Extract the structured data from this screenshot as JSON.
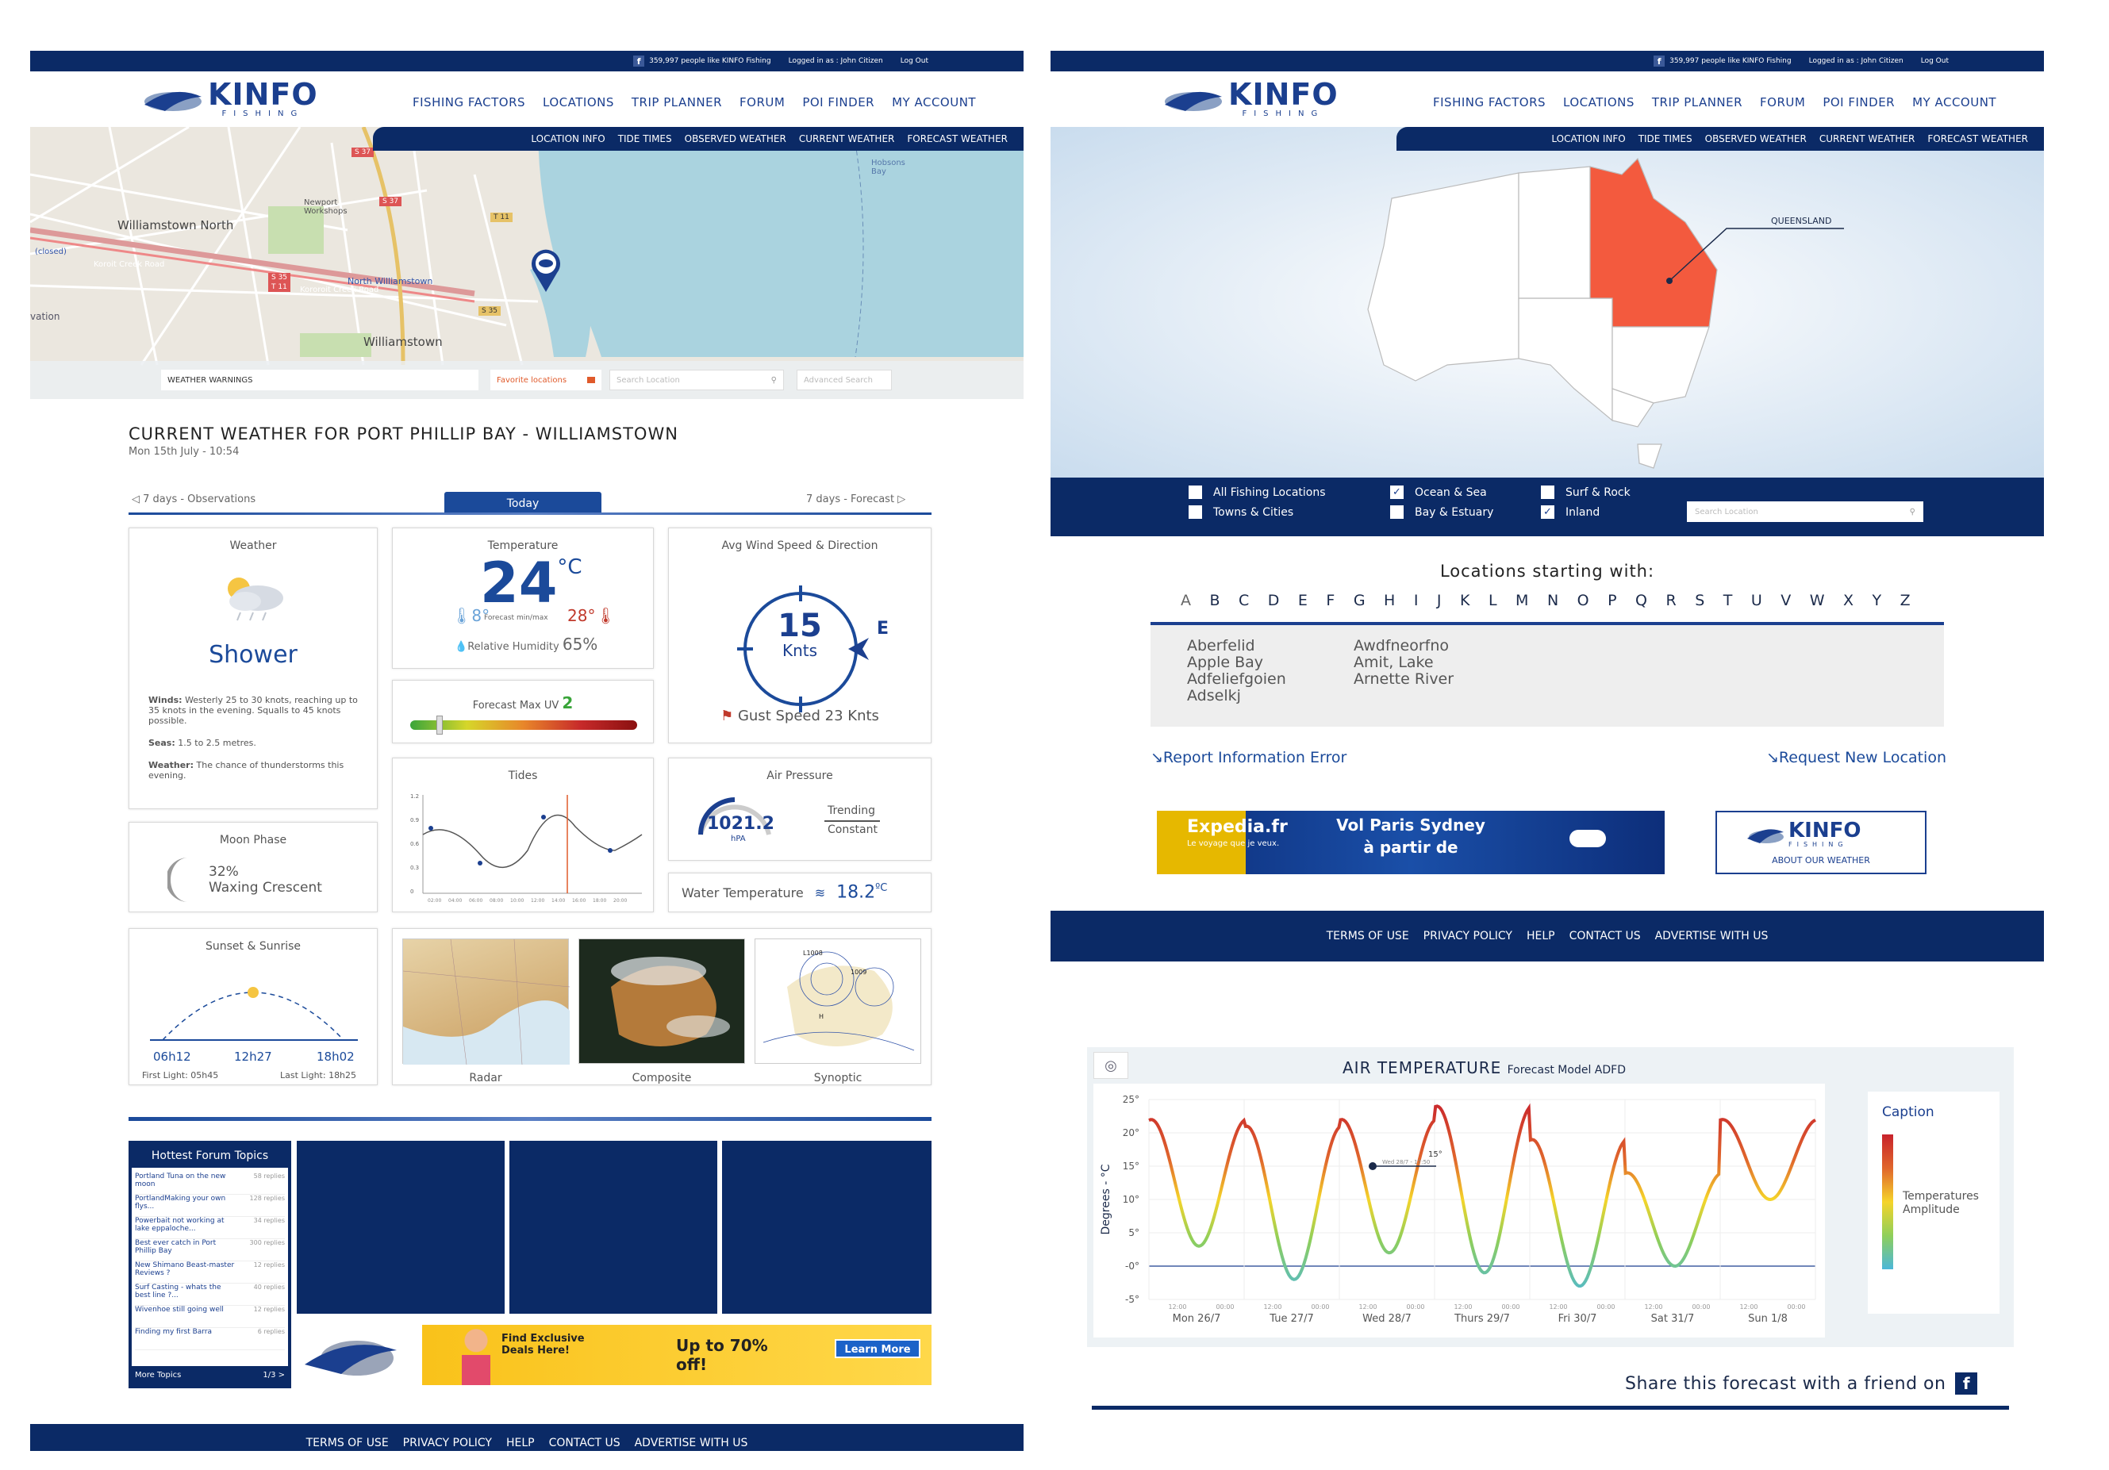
{
  "facebook": {
    "likes_text": "359,997 people like KINFO Fishing"
  },
  "user": {
    "logged_in_text": "Logged in as : John Citizen",
    "logout_label": "Log Out"
  },
  "brand": {
    "name": "KINFO",
    "sub": "FISHING",
    "about_weather": "ABOUT OUR WEATHER"
  },
  "main_nav": [
    "FISHING FACTORS",
    "LOCATIONS",
    "TRIP PLANNER",
    "FORUM",
    "POI FINDER",
    "MY ACCOUNT"
  ],
  "sub_nav": [
    "LOCATION INFO",
    "TIDE TIMES",
    "OBSERVED WEATHER",
    "CURRENT WEATHER",
    "FORECAST WEATHER"
  ],
  "map": {
    "labels": [
      "Williamstown North",
      "Williamstown",
      "North Williamstown",
      "Koroit Creek Road",
      "Kororoit Creek Road",
      "(closed)",
      "Newport Workshops",
      "Hobsons Bay",
      "S 37",
      "S 37",
      "T 11",
      "S 35",
      "T 11",
      "S 35",
      "vation"
    ],
    "weather_warnings": "WEATHER WARNINGS",
    "favorite_locations": "Favorite locations",
    "search_placeholder": "Search Location",
    "advanced_search": "Advanced Search"
  },
  "current": {
    "title": "CURRENT WEATHER FOR PORT PHILLIP BAY - WILLIAMSTOWN",
    "date": "Mon 15th July - 10:54",
    "tab_prev": "7 days - Observations",
    "tab_today": "Today",
    "tab_next": "7 days - Forecast",
    "weather": {
      "title": "Weather",
      "condition": "Shower",
      "winds_label": "Winds:",
      "winds_text": "Westerly 25 to 30 knots, reaching up to 35 knots in the evening. Squalls to 45 knots possible.",
      "seas_label": "Seas:",
      "seas_text": "1.5 to 2.5 metres.",
      "weather_label": "Weather:",
      "weather_text": "The chance of thunderstorms this evening."
    },
    "temperature": {
      "title": "Temperature",
      "value": "24",
      "unit": "°C",
      "min": "8°",
      "max": "28°",
      "minmax_label": "Forecast min/max",
      "humidity_label": "Relative Humidity",
      "humidity": "65%"
    },
    "uv": {
      "title": "Forecast Max UV",
      "value": "2",
      "level": 0.13
    },
    "wind": {
      "title": "Avg Wind Speed & Direction",
      "speed": "15",
      "unit": "Knts",
      "direction": "E",
      "gust_label": "Gust Speed",
      "gust": "23 Knts"
    },
    "tides": {
      "title": "Tides"
    },
    "pressure": {
      "title": "Air Pressure",
      "value": "1021.2",
      "unit": "hPA",
      "trend_label": "Trending",
      "trend": "Constant"
    },
    "water": {
      "label": "Water Temperature",
      "value": "18.2",
      "unit": "ºC"
    },
    "moon": {
      "title": "Moon Phase",
      "percent": "32%",
      "phase": "Waxing Crescent"
    },
    "sun": {
      "title": "Sunset & Sunrise",
      "times": [
        "06h12",
        "12h27",
        "18h02"
      ],
      "first_light": "First Light: 05h45",
      "last_light": "Last Light: 18h25"
    },
    "maps": [
      "Radar",
      "Composite",
      "Synoptic"
    ]
  },
  "forum": {
    "title": "Hottest Forum Topics",
    "topics": [
      {
        "title": "Portland Tuna on the new moon",
        "replies": "58 replies"
      },
      {
        "title": "PortlandMaking your own flys...",
        "replies": "128 replies"
      },
      {
        "title": "Powerbait not working at lake eppaloche...",
        "replies": "34 replies"
      },
      {
        "title": "Best ever catch in Port Phillip Bay",
        "replies": "300 replies"
      },
      {
        "title": "New Shimano Beast-master Reviews ?",
        "replies": "12 replies"
      },
      {
        "title": "Surf Casting - whats the best line ?...",
        "replies": "40 replies"
      },
      {
        "title": "Wivenhoe still going well",
        "replies": "12 replies"
      },
      {
        "title": "Finding my first Barra",
        "replies": "6 replies"
      }
    ],
    "more": "More Topics",
    "pager": "1/3 >"
  },
  "ad1": {
    "headline": "Find Exclusive Deals Here!",
    "offer": "Up to 70% off!",
    "cta": "Learn More"
  },
  "footer": [
    "TERMS OF USE",
    "PRIVACY POLICY",
    "HELP",
    "CONTACT US",
    "ADVERTISE WITH US"
  ],
  "locations": {
    "state_label": "QUEENSLAND",
    "filters": [
      {
        "label": "All Fishing Locations",
        "checked": false
      },
      {
        "label": "Ocean & Sea",
        "checked": true
      },
      {
        "label": "Surf & Rock",
        "checked": false
      },
      {
        "label": "Towns & Cities",
        "checked": false
      },
      {
        "label": "Bay & Estuary",
        "checked": false
      },
      {
        "label": "Inland",
        "checked": true
      }
    ],
    "search_placeholder": "Search Location",
    "starting_with": "Locations starting with:",
    "letters": [
      "A",
      "B",
      "C",
      "D",
      "E",
      "F",
      "G",
      "H",
      "I",
      "J",
      "K",
      "L",
      "M",
      "N",
      "O",
      "P",
      "Q",
      "R",
      "S",
      "T",
      "U",
      "V",
      "W",
      "X",
      "Y",
      "Z"
    ],
    "col1": [
      "Aberfelid",
      "Apple Bay",
      "Adfeliefgoien",
      "Adselkj"
    ],
    "col2": [
      "Awdfneorfno",
      "Amit, Lake",
      "Arnette River"
    ],
    "report": "Report Information Error",
    "request": "Request New Location"
  },
  "ad2": {
    "brand": "Expedia.fr",
    "tagline": "Le voyage que je veux.",
    "line1": "Vol Paris Sydney",
    "line2": "à partir de"
  },
  "airtemp": {
    "title": "AIR TEMPERATURE",
    "model": "Forecast Model ADFD",
    "caption": "Caption",
    "legend": "Temperatures Amplitude",
    "tooltip_value": "15°",
    "tooltip_label": "Wed 28/7 - 17:50",
    "share": "Share this forecast with a friend on"
  },
  "chart_data": {
    "type": "line",
    "title": "AIR TEMPERATURE",
    "ylabel": "Degrees - °C",
    "ylim": [
      -5,
      25
    ],
    "yticks": [
      "25°",
      "20°",
      "15°",
      "10°",
      "5°",
      "-0°",
      "-5°"
    ],
    "days": [
      "Mon 26/7",
      "Tue 27/7",
      "Wed 28/7",
      "Thurs 29/7",
      "Fri 30/7",
      "Sat 31/7",
      "Sun 1/8"
    ],
    "sub_ticks": [
      "12:00",
      "00:00"
    ],
    "highs": [
      22,
      21,
      22,
      24,
      19,
      14,
      22
    ],
    "lows": [
      3,
      -2,
      2,
      -1,
      -3,
      0,
      10
    ]
  }
}
